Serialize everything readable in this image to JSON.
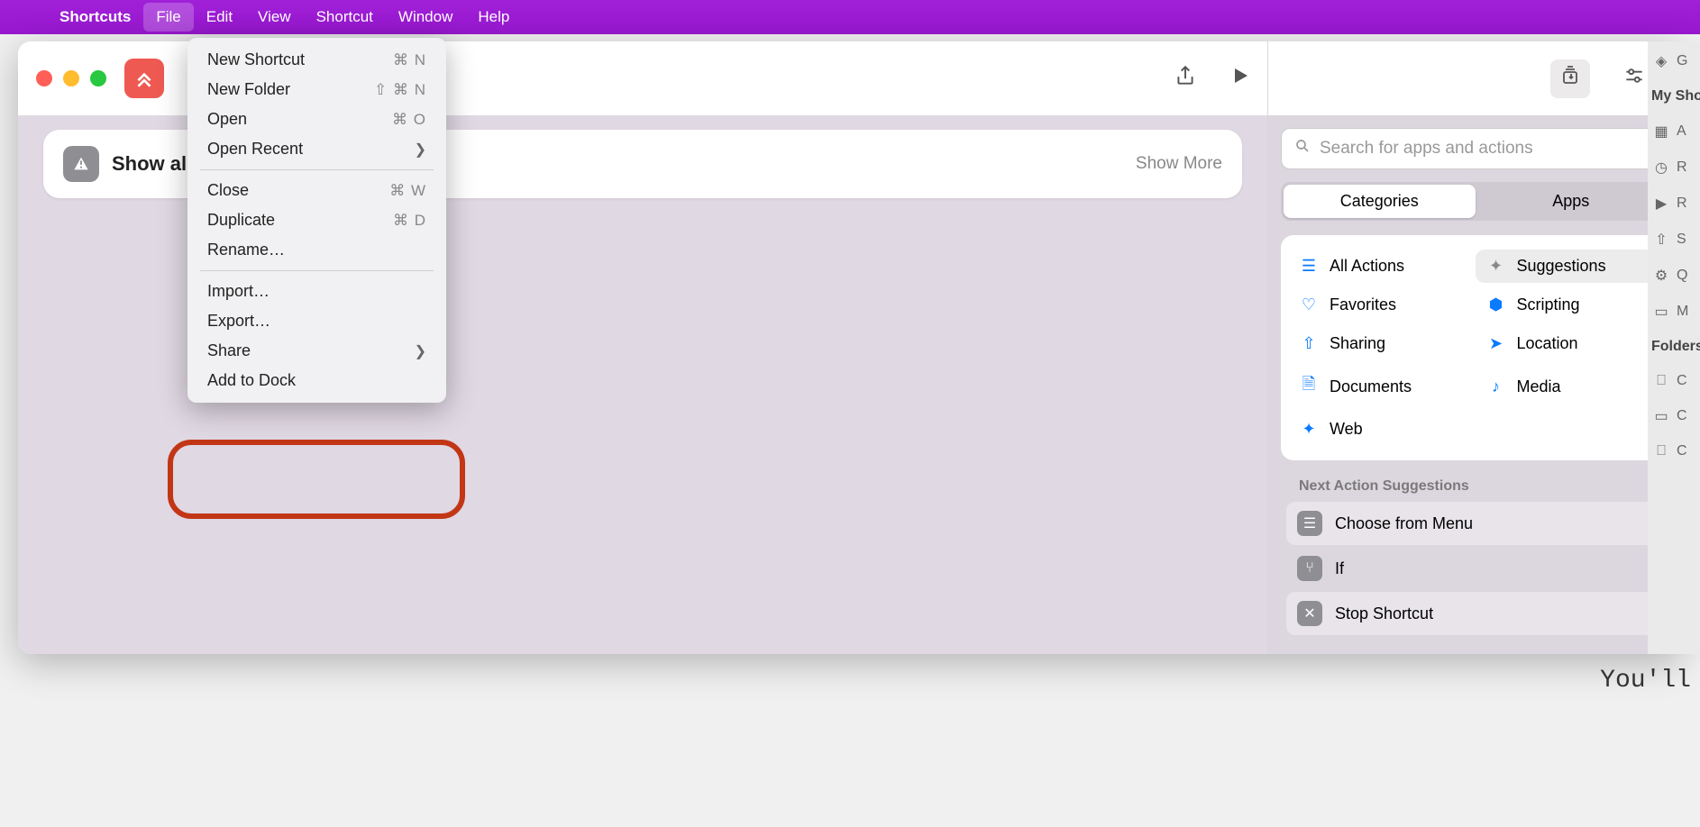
{
  "menubar": {
    "app": "Shortcuts",
    "items": [
      "File",
      "Edit",
      "View",
      "Shortcut",
      "Window",
      "Help"
    ],
    "active_index": 0
  },
  "dropdown": {
    "items": [
      {
        "label": "New Shortcut",
        "shortcut": "⌘ N"
      },
      {
        "label": "New Folder",
        "shortcut": "⇧ ⌘ N"
      },
      {
        "label": "Open",
        "shortcut": "⌘ O"
      },
      {
        "label": "Open Recent",
        "submenu": true
      }
    ],
    "items2": [
      {
        "label": "Close",
        "shortcut": "⌘ W"
      },
      {
        "label": "Duplicate",
        "shortcut": "⌘ D"
      },
      {
        "label": "Rename…"
      }
    ],
    "items3": [
      {
        "label": "Import…"
      },
      {
        "label": "Export…"
      },
      {
        "label": "Share",
        "submenu": true
      },
      {
        "label": "Add to Dock"
      }
    ]
  },
  "action_card": {
    "label": "Show aler",
    "more": "Show More"
  },
  "sidebar": {
    "search_placeholder": "Search for apps and actions",
    "segments": [
      "Categories",
      "Apps"
    ],
    "active_segment": 0,
    "categories_left": [
      "All Actions",
      "Favorites",
      "Sharing",
      "Documents",
      "Web"
    ],
    "categories_right": [
      "Suggestions",
      "Scripting",
      "Location",
      "Media"
    ],
    "selected_right_index": 0,
    "suggestions_header": "Next Action Suggestions",
    "suggestions": [
      "Choose from Menu",
      "If",
      "Stop Shortcut"
    ]
  },
  "rstrip": {
    "items": [
      "G",
      "My Sho",
      "A",
      "R",
      "R",
      "S",
      "Q",
      "M",
      "Folders",
      "C",
      "C",
      "C"
    ]
  },
  "bottom_text": "You'll"
}
